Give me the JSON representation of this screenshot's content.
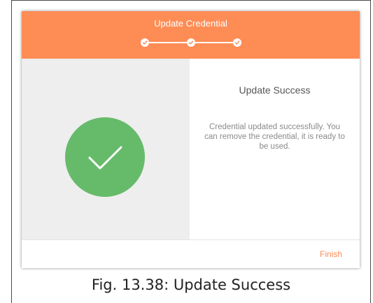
{
  "dialog": {
    "title": "Update Credential",
    "steps": [
      "complete",
      "complete",
      "complete"
    ],
    "heading": "Update Success",
    "message": "Credential updated successfully. You can remove the credential, it is ready to be used.",
    "finish_label": "Finish"
  },
  "figure": {
    "caption": "Fig. 13.38: Update Success"
  },
  "colors": {
    "header": "#fe8c55",
    "success": "#66bb6a",
    "accent": "#fe8c55"
  },
  "icons": {
    "step": "check-icon",
    "success": "checkmark-icon"
  }
}
